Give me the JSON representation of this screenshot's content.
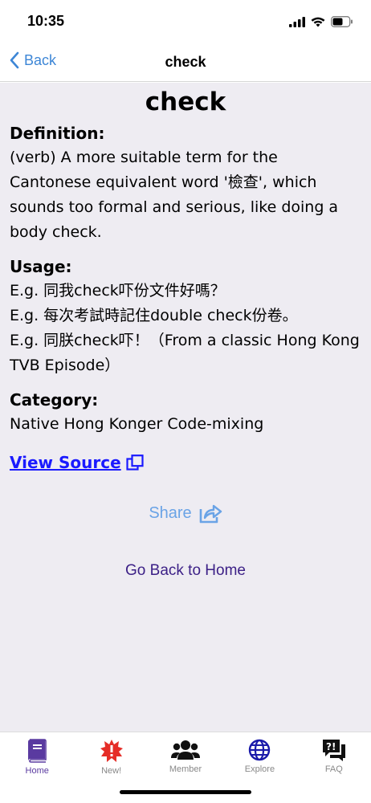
{
  "status": {
    "time": "10:35"
  },
  "nav": {
    "back_label": "Back",
    "title": "check"
  },
  "term": {
    "title": "check",
    "definition_label": "Definition:",
    "definition_text": "(verb) A more suitable term for the Cantonese equivalent word '檢查', which sounds too formal and serious, like doing a body check.",
    "usage_label": "Usage:",
    "usage": [
      "E.g. 同我check吓份文件好嗎？",
      "E.g. 每次考試時記住double check份卷。",
      "E.g. 同朕check吓！（From a classic Hong Kong TVB Episode）"
    ],
    "category_label": "Category:",
    "category_text": "Native Hong Konger Code-mixing",
    "view_source_label": "View Source"
  },
  "actions": {
    "share_label": "Share",
    "home_label": "Go Back to Home"
  },
  "tabs": [
    {
      "label": "Home",
      "icon": "book-icon"
    },
    {
      "label": "New!",
      "icon": "burst-alert-icon"
    },
    {
      "label": "Member",
      "icon": "users-icon"
    },
    {
      "label": "Explore",
      "icon": "globe-icon"
    },
    {
      "label": "FAQ",
      "icon": "question-chat-icon"
    }
  ],
  "colors": {
    "accent_blue": "#3d86d6",
    "link_blue": "#1a1aff",
    "share_blue": "#6aa3e6",
    "purple": "#5a3aa0",
    "alert_red": "#e52d27",
    "content_bg": "#eeecf2"
  }
}
